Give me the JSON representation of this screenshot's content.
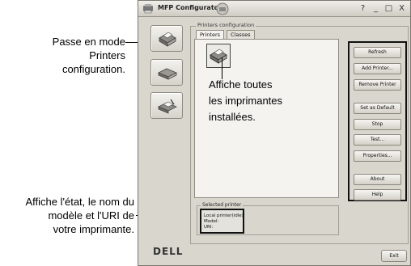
{
  "annotations": {
    "mode": [
      "Passe en mode",
      "Printers",
      "configuration."
    ],
    "installed": [
      "Affiche toutes",
      "les imprimantes",
      "installées."
    ],
    "status": [
      "Affiche l'état, le nom du",
      "modèle et l'URI de",
      "votre imprimante."
    ]
  },
  "window": {
    "title": "MFP Configurator",
    "controls": [
      "?",
      "_",
      "□",
      "X"
    ]
  },
  "group_title": "Printers configuration",
  "tabs": [
    "Printers",
    "Classes"
  ],
  "buttons": [
    "Refresh",
    "Add Printer...",
    "Remove Printer",
    "Set as Default",
    "Stop",
    "Test...",
    "Properties...",
    "About",
    "Help"
  ],
  "selected": {
    "label": "Selected printer",
    "lines": [
      "Local printer(idle)",
      "Model:",
      "URI:"
    ]
  },
  "brand": "DELL",
  "exit_label": "Exit"
}
